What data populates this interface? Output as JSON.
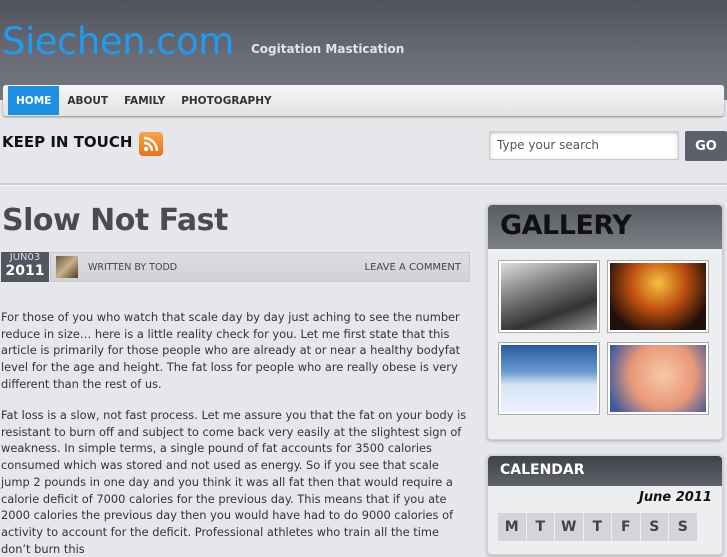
{
  "site": {
    "title": "Siechen.com",
    "tagline": "Cogitation Mastication"
  },
  "nav": [
    {
      "label": "HOME",
      "active": true
    },
    {
      "label": "ABOUT"
    },
    {
      "label": "FAMILY"
    },
    {
      "label": "PHOTOGRAPHY"
    }
  ],
  "keep_in_touch": "KEEP IN TOUCH",
  "search": {
    "placeholder": "Type your search",
    "button": "GO"
  },
  "post": {
    "title": "Slow Not Fast",
    "month_day": "JUN03",
    "year": "2011",
    "author": "WRITTEN BY TODD",
    "comment": "LEAVE A COMMENT",
    "paragraphs": [
      "For those of you who watch that scale day by day just aching to see the number reduce in size… here is a little reality check for you. Let me first state that this article is primarily for those people who are already at or near a healthy bodyfat level for the age and height. The fat loss for people who are really obese is very different than the rest of us.",
      "Fat loss is a slow, not fast process. Let me assure you that the fat on your body is resistant to burn off and subject to come back very easily at the slightest sign of weakness. In simple terms, a single pound of fat accounts for 3500 calories consumed which was stored and not used as energy. So if you see that scale jump 2 pounds in one day and you think it was all fat then that would require a calorie deficit of 7000 calories for the previous day. This means that if you ate 2000 calories the previous day then you would have had to do 9000 calories of activity to account for the deficit. Professional athletes who train all the time don’t burn this"
    ]
  },
  "gallery": {
    "title": "GALLERY"
  },
  "calendar": {
    "title": "CALENDAR",
    "month": "June 2011",
    "days": [
      "M",
      "T",
      "W",
      "T",
      "F",
      "S",
      "S"
    ]
  }
}
